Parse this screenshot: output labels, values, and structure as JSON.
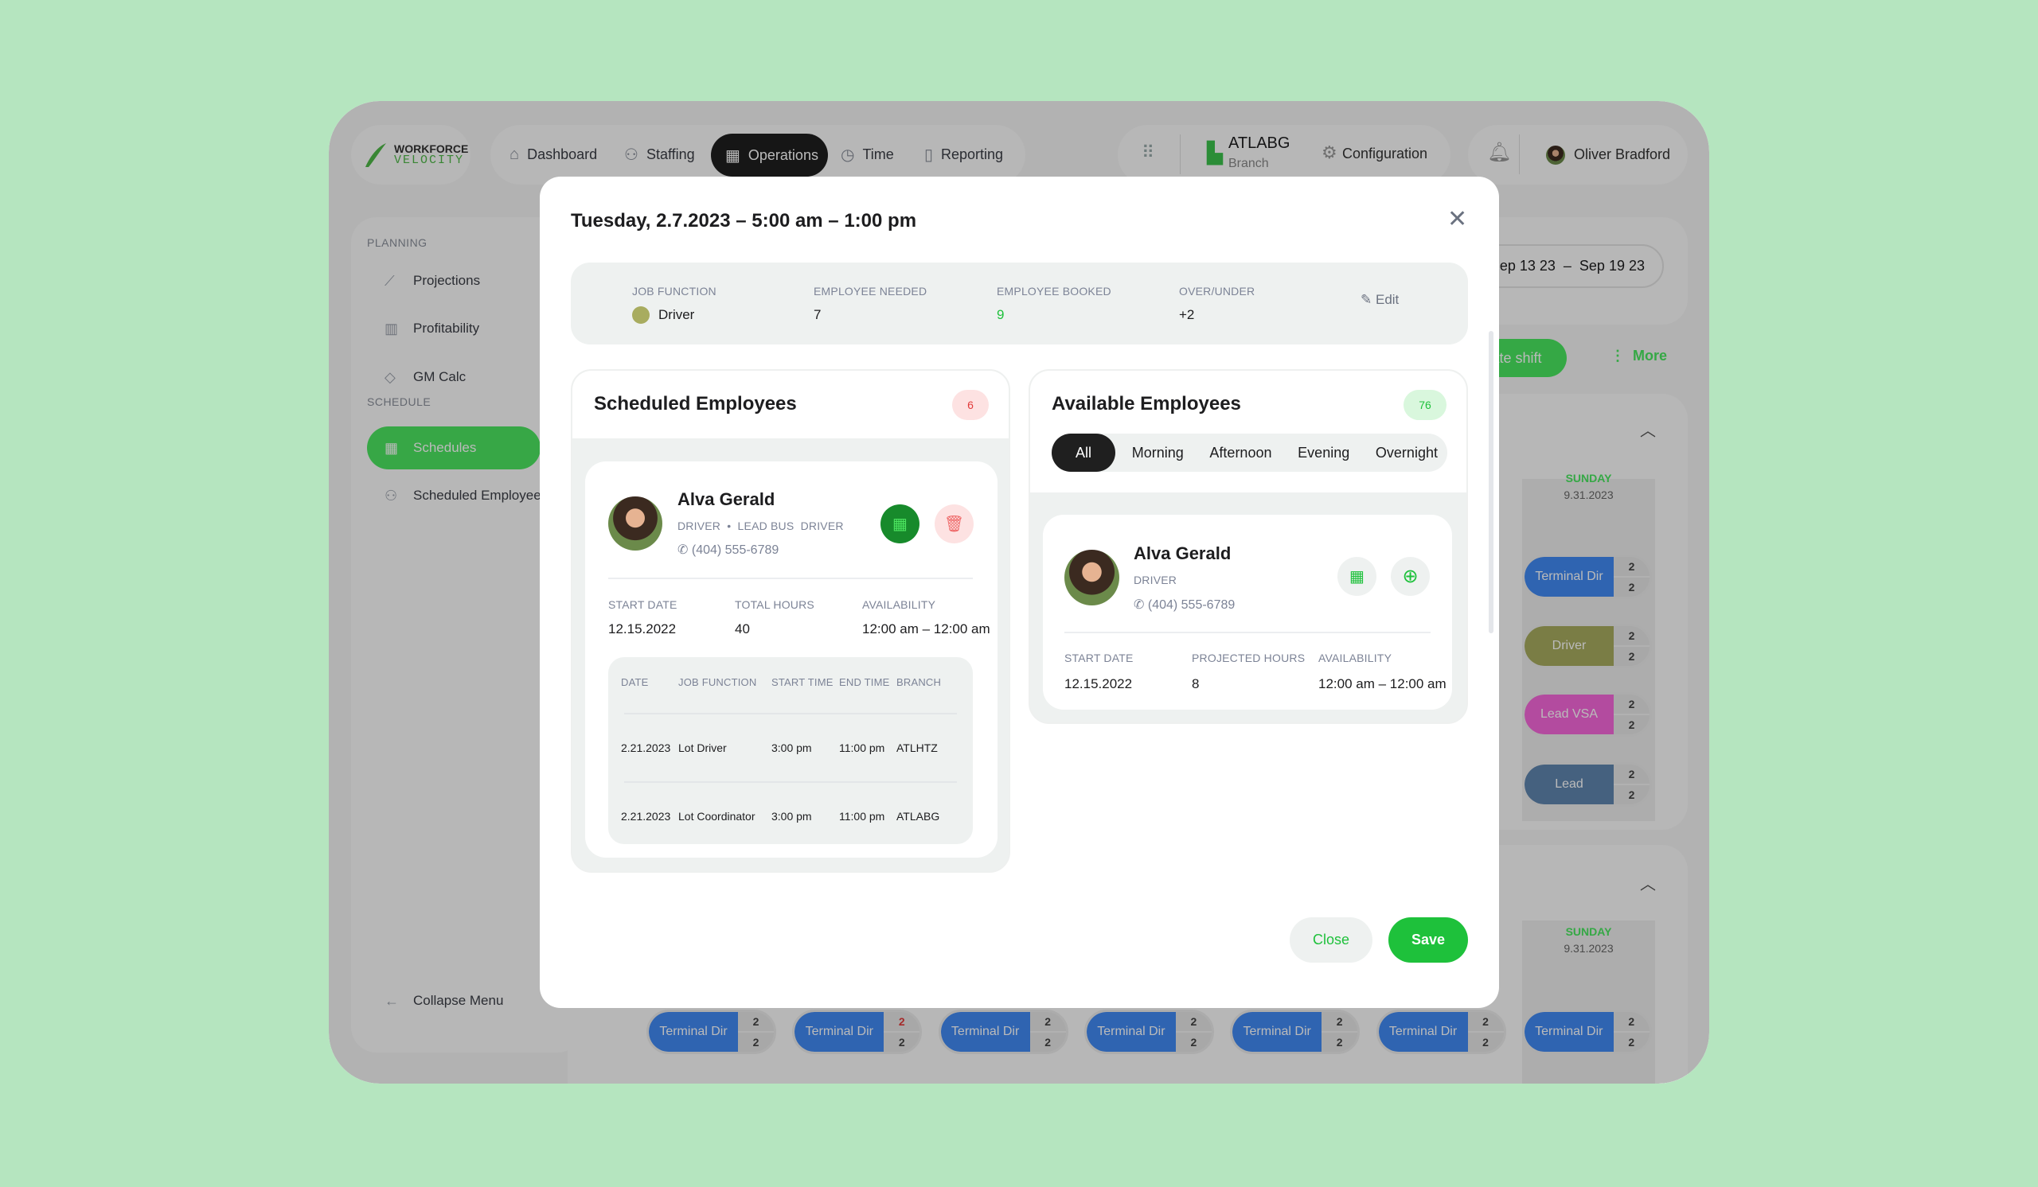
{
  "colors": {
    "accent": "#1ec13b",
    "dark": "#1f1f1f",
    "terminal_dir": "#4189f3",
    "driver": "#a8ac5f",
    "lead_vsa": "#f668db",
    "lead": "#5f85af",
    "danger": "#e23b3b"
  },
  "logo": {
    "line1": "WORKFORCE",
    "line2": "VELOCITY"
  },
  "nav": {
    "items": [
      {
        "label": "Dashboard",
        "icon": "home-icon"
      },
      {
        "label": "Staffing",
        "icon": "users-icon"
      },
      {
        "label": "Operations",
        "icon": "calendar-icon",
        "active": true
      },
      {
        "label": "Time",
        "icon": "clock-icon"
      },
      {
        "label": "Reporting",
        "icon": "document-icon"
      }
    ]
  },
  "header": {
    "branch_code": "ATLABG",
    "branch_label": "Branch",
    "configuration": "Configuration",
    "user_name": "Oliver Bradford"
  },
  "sidebar": {
    "planning_heading": "PLANNING",
    "planning": [
      "Projections",
      "Profitability",
      "GM Calc"
    ],
    "schedule_heading": "SCHEDULE",
    "schedule": [
      "Schedules",
      "Scheduled Employees"
    ],
    "collapse": "Collapse Menu"
  },
  "background": {
    "date_range": "Sep 13 23  –  Sep 19 23",
    "create_shift": "Create shift",
    "more": "More",
    "day_name": "SUNDAY",
    "day_date": "9.31.2023",
    "sunday_shifts": [
      {
        "label": "Terminal Dir",
        "top": "2",
        "bottom": "2",
        "color": "terminal_dir"
      },
      {
        "label": "Driver",
        "top": "2",
        "bottom": "2",
        "color": "driver"
      },
      {
        "label": "Lead VSA",
        "top": "2",
        "bottom": "2",
        "color": "lead_vsa"
      },
      {
        "label": "Lead",
        "top": "2",
        "bottom": "2",
        "color": "lead"
      }
    ],
    "bottom_shifts": [
      {
        "label": "Terminal Dir",
        "top": "2",
        "bottom": "2"
      },
      {
        "label": "Terminal Dir",
        "top": "2",
        "bottom": "2",
        "top_alert": true
      },
      {
        "label": "Terminal Dir",
        "top": "2",
        "bottom": "2"
      },
      {
        "label": "Terminal Dir",
        "top": "2",
        "bottom": "2"
      },
      {
        "label": "Terminal Dir",
        "top": "2",
        "bottom": "2"
      },
      {
        "label": "Terminal Dir",
        "top": "2",
        "bottom": "2"
      },
      {
        "label": "Terminal Dir",
        "top": "2",
        "bottom": "2"
      }
    ]
  },
  "modal": {
    "title": "Tuesday, 2.7.2023 – 5:00 am – 1:00 pm",
    "summary": {
      "job_function_label": "JOB FUNCTION",
      "job_function": "Driver",
      "needed_label": "EMPLOYEE NEEDED",
      "needed": "7",
      "booked_label": "EMPLOYEE BOOKED",
      "booked": "9",
      "over_under_label": "OVER/UNDER",
      "over_under": "+2",
      "edit": "Edit"
    },
    "scheduled": {
      "title": "Scheduled Employees",
      "count": "6",
      "employee": {
        "name": "Alva Gerald",
        "roles": "DRIVER  •  LEAD BUS  DRIVER",
        "phone": "(404) 555-6789",
        "start_date_label": "START DATE",
        "start_date": "12.15.2022",
        "hours_label": "TOTAL HOURS",
        "hours": "40",
        "availability_label": "AVAILABILITY",
        "availability": "12:00 am – 12:00 am"
      },
      "table": {
        "headers": [
          "DATE",
          "JOB FUNCTION",
          "START TIME",
          "END TIME",
          "BRANCH"
        ],
        "rows": [
          [
            "2.21.2023",
            "Lot Driver",
            "3:00 pm",
            "11:00 pm",
            "ATLHTZ"
          ],
          [
            "2.21.2023",
            "Lot Coordinator",
            "3:00 pm",
            "11:00 pm",
            "ATLABG"
          ]
        ]
      }
    },
    "available": {
      "title": "Available Employees",
      "count": "76",
      "tabs": [
        "All",
        "Morning",
        "Afternoon",
        "Evening",
        "Overnight"
      ],
      "active_tab": "All",
      "employee": {
        "name": "Alva Gerald",
        "roles": "DRIVER",
        "phone": "(404) 555-6789",
        "start_date_label": "START DATE",
        "start_date": "12.15.2022",
        "hours_label": "PROJECTED HOURS",
        "hours": "8",
        "availability_label": "AVAILABILITY",
        "availability": "12:00 am – 12:00 am"
      }
    },
    "close": "Close",
    "save": "Save"
  }
}
